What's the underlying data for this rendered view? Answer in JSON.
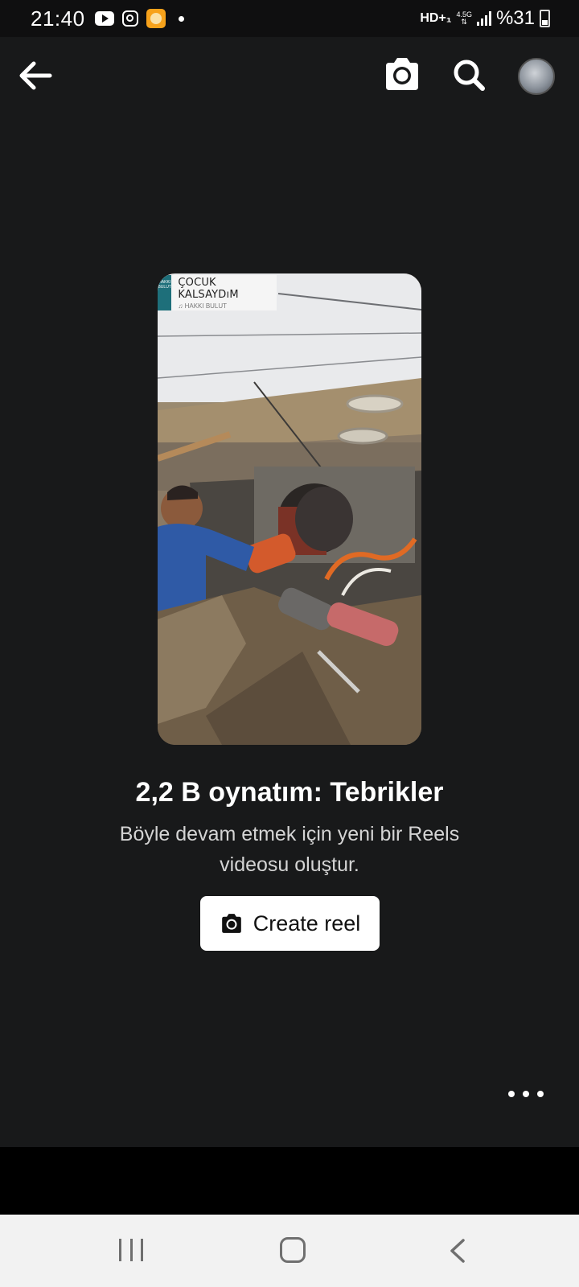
{
  "status_bar": {
    "time": "21:40",
    "network": "HD+₁",
    "lte_top": "4.5G",
    "battery": "%31",
    "icons": [
      "youtube-icon",
      "instagram-icon",
      "app-notification-icon",
      "dot-icon",
      "signal-icon",
      "battery-icon"
    ]
  },
  "app_bar": {
    "icons": [
      "back-arrow-icon",
      "camera-icon",
      "search-icon",
      "avatar"
    ]
  },
  "reel": {
    "music_title": "ÇOCUK KALSAYDıM",
    "music_artist": "♫ HAKKI BULUT",
    "thumb_text": "HAKKI BULUT"
  },
  "main": {
    "headline": "2,2 B oynatım: Tebrikler",
    "subtext": "Böyle devam etmek için yeni bir Reels videosu oluştur.",
    "create_button_label": "Create reel"
  },
  "nav_bar": {
    "icons": [
      "recents-icon",
      "home-icon",
      "back-icon"
    ]
  }
}
